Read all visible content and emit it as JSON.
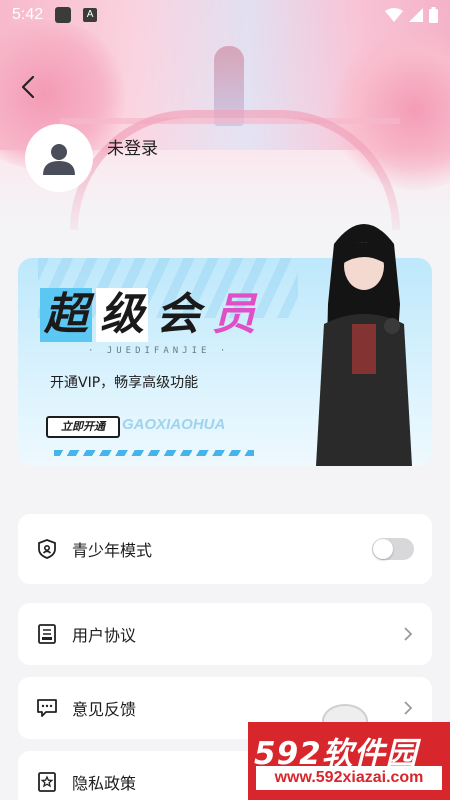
{
  "status_bar": {
    "time": "5:42",
    "a_badge": "A"
  },
  "profile": {
    "login_text": "未登录"
  },
  "vip_banner": {
    "title_chars": [
      "超",
      "级",
      "会",
      "员"
    ],
    "subtitle": "· JUEDIFANJIE ·",
    "desc": "开通VIP，畅享高级功能",
    "button": "立即开通",
    "watermark": "GAOXIAOHUA"
  },
  "menu": {
    "teen_mode": {
      "label": "青少年模式",
      "toggle_on": false
    },
    "user_agreement": {
      "label": "用户协议"
    },
    "feedback": {
      "label": "意见反馈"
    },
    "privacy": {
      "label": "隐私政策"
    }
  },
  "overlay_watermark": {
    "brand": "592软件园",
    "url": "www.592xiazai.com"
  },
  "colors": {
    "accent_blue": "#5cc7f2",
    "vip_pink": "#e04fc6",
    "watermark_red": "#d7262c"
  }
}
